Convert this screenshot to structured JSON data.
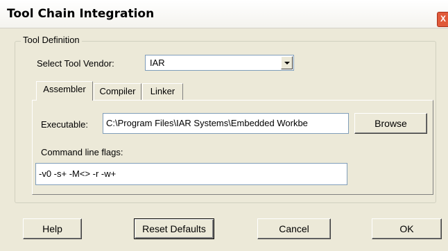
{
  "window": {
    "title": "Tool Chain Integration",
    "close_glyph": "X"
  },
  "group": {
    "legend": "Tool Definition"
  },
  "vendor": {
    "label": "Select Tool Vendor:",
    "value": "IAR"
  },
  "tabs": [
    {
      "label": "Assembler",
      "active": true
    },
    {
      "label": "Compiler",
      "active": false
    },
    {
      "label": "Linker",
      "active": false
    }
  ],
  "assembler": {
    "executable_label": "Executable:",
    "executable_value": "C:\\Program Files\\IAR Systems\\Embedded Workbe",
    "browse_label": "Browse",
    "flags_label": "Command line flags:",
    "flags_value": "-v0 -s+ -M<> -r -w+"
  },
  "footer": {
    "help_label": "Help",
    "reset_label": "Reset Defaults",
    "cancel_label": "Cancel",
    "ok_label": "OK"
  }
}
